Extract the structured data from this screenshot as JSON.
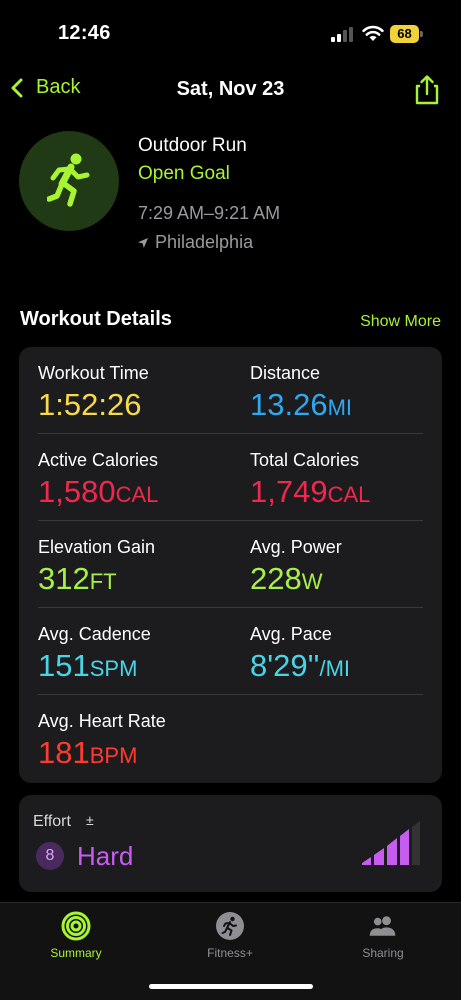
{
  "status_bar": {
    "time": "12:46",
    "battery": "68"
  },
  "nav": {
    "back_label": "Back",
    "title": "Sat, Nov 23"
  },
  "workout": {
    "type": "Outdoor Run",
    "goal": "Open Goal",
    "time_range": "7:29 AM–9:21 AM",
    "location": "Philadelphia"
  },
  "section": {
    "title": "Workout Details",
    "show_more": "Show More"
  },
  "metrics": [
    {
      "label": "Workout Time",
      "value": "1:52:26",
      "unit": "",
      "color": "#f7d94c"
    },
    {
      "label": "Distance",
      "value": "13.26",
      "unit": "MI",
      "color": "#2ea8f0"
    },
    {
      "label": "Active Calories",
      "value": "1,580",
      "unit": "CAL",
      "color": "#f0284e"
    },
    {
      "label": "Total Calories",
      "value": "1,749",
      "unit": "CAL",
      "color": "#f0284e"
    },
    {
      "label": "Elevation Gain",
      "value": "312",
      "unit": "FT",
      "color": "#a6f04a"
    },
    {
      "label": "Avg. Power",
      "value": "228",
      "unit": "W",
      "color": "#a6f04a"
    },
    {
      "label": "Avg. Cadence",
      "value": "151",
      "unit": "SPM",
      "color": "#4ad4e6"
    },
    {
      "label": "Avg. Pace",
      "value": "8'29''",
      "unit": "/MI",
      "color": "#4ad4e6"
    },
    {
      "label": "Avg. Heart Rate",
      "value": "181",
      "unit": "BPM",
      "color": "#ff3b2f"
    }
  ],
  "effort": {
    "label": "Effort",
    "adjust_symbol": "±",
    "level": "8",
    "value": "Hard",
    "color": "#c65df0"
  },
  "tabs": [
    {
      "label": "Summary",
      "icon": "summary-rings-icon",
      "active": true
    },
    {
      "label": "Fitness+",
      "icon": "fitness-plus-icon",
      "active": false
    },
    {
      "label": "Sharing",
      "icon": "sharing-people-icon",
      "active": false
    }
  ],
  "colors": {
    "accent": "#a7f432",
    "card": "#1c1c1e",
    "background": "#000000"
  }
}
